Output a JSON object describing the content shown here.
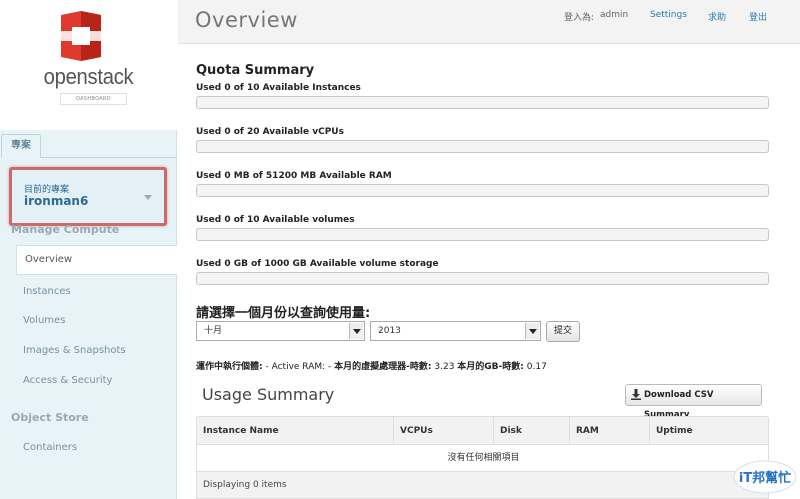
{
  "brand": {
    "name": "openstack",
    "sub": "DASHBOARD",
    "color": "#d9322a"
  },
  "sidebar": {
    "tab_label": "專案",
    "project_label": "目前的專案",
    "project_name": "ironman6",
    "compute_header": "Manage Compute",
    "compute_items": [
      {
        "label": "Overview",
        "active": true
      },
      {
        "label": "Instances"
      },
      {
        "label": "Volumes"
      },
      {
        "label": "Images & Snapshots"
      },
      {
        "label": "Access & Security"
      }
    ],
    "store_header": "Object Store",
    "store_items": [
      {
        "label": "Containers"
      }
    ]
  },
  "header": {
    "title": "Overview",
    "login_label": "登入為:",
    "username": "admin",
    "settings": "Settings",
    "help": "求助",
    "logout": "登出"
  },
  "quota": {
    "title": "Quota Summary",
    "items": [
      {
        "label": "Used 0 of 10 Available Instances",
        "fraction": 0
      },
      {
        "label": "Used 0 of 20 Available vCPUs",
        "fraction": 0
      },
      {
        "label": "Used 0 MB of 51200 MB Available RAM",
        "fraction": 0
      },
      {
        "label": "Used 0 of 10 Available volumes",
        "fraction": 0
      },
      {
        "label": "Used 0 GB of 1000 GB Available volume storage",
        "fraction": 0
      }
    ]
  },
  "usage_query": {
    "title": "請選擇一個月份以查詢使用量:",
    "month": "十月",
    "year": "2013",
    "submit": "提交"
  },
  "usage_stats": {
    "active_label": "運作中執行個體:",
    "active_value": "-",
    "ram_label": "Active RAM:",
    "ram_value": "-",
    "cpu_label": "本月的虛擬處理器-時數:",
    "cpu_value": "3.23",
    "gb_label": "本月的GB-時數:",
    "gb_value": "0.17"
  },
  "usage_summary": {
    "title": "Usage Summary",
    "csv_button": "Download CSV Summary",
    "columns": [
      "Instance Name",
      "VCPUs",
      "Disk",
      "RAM",
      "Uptime"
    ],
    "empty_message": "沒有任何相關項目",
    "footer": "Displaying 0 items"
  },
  "watermark": {
    "text": "iT邦幫忙"
  }
}
